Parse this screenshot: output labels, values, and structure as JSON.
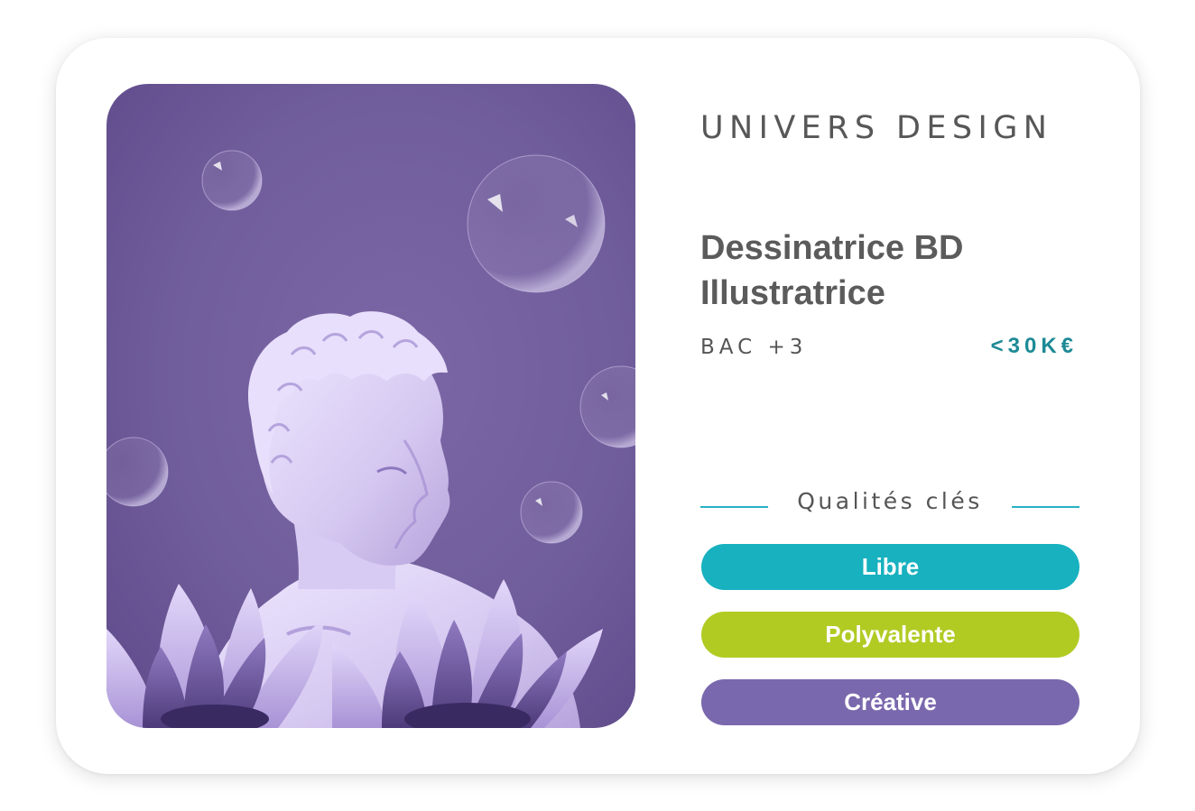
{
  "card": {
    "category": "UNIVERS DESIGN",
    "title_lines": [
      "Dessinatrice BD",
      "Illustratrice"
    ],
    "level": "BAC +3",
    "salary": "<30K€",
    "image": "statue-bust-with-bubbles-and-flowers"
  },
  "qualities": {
    "header": "Qualités clés",
    "items": [
      {
        "label": "Libre",
        "color": "#17b1bf"
      },
      {
        "label": "Polyvalente",
        "color": "#b1cb23"
      },
      {
        "label": "Créative",
        "color": "#7a68ae"
      }
    ]
  },
  "colors": {
    "accent": "#1d8a96",
    "line": "#27b2c2",
    "photo_tint": "#705d9b"
  }
}
